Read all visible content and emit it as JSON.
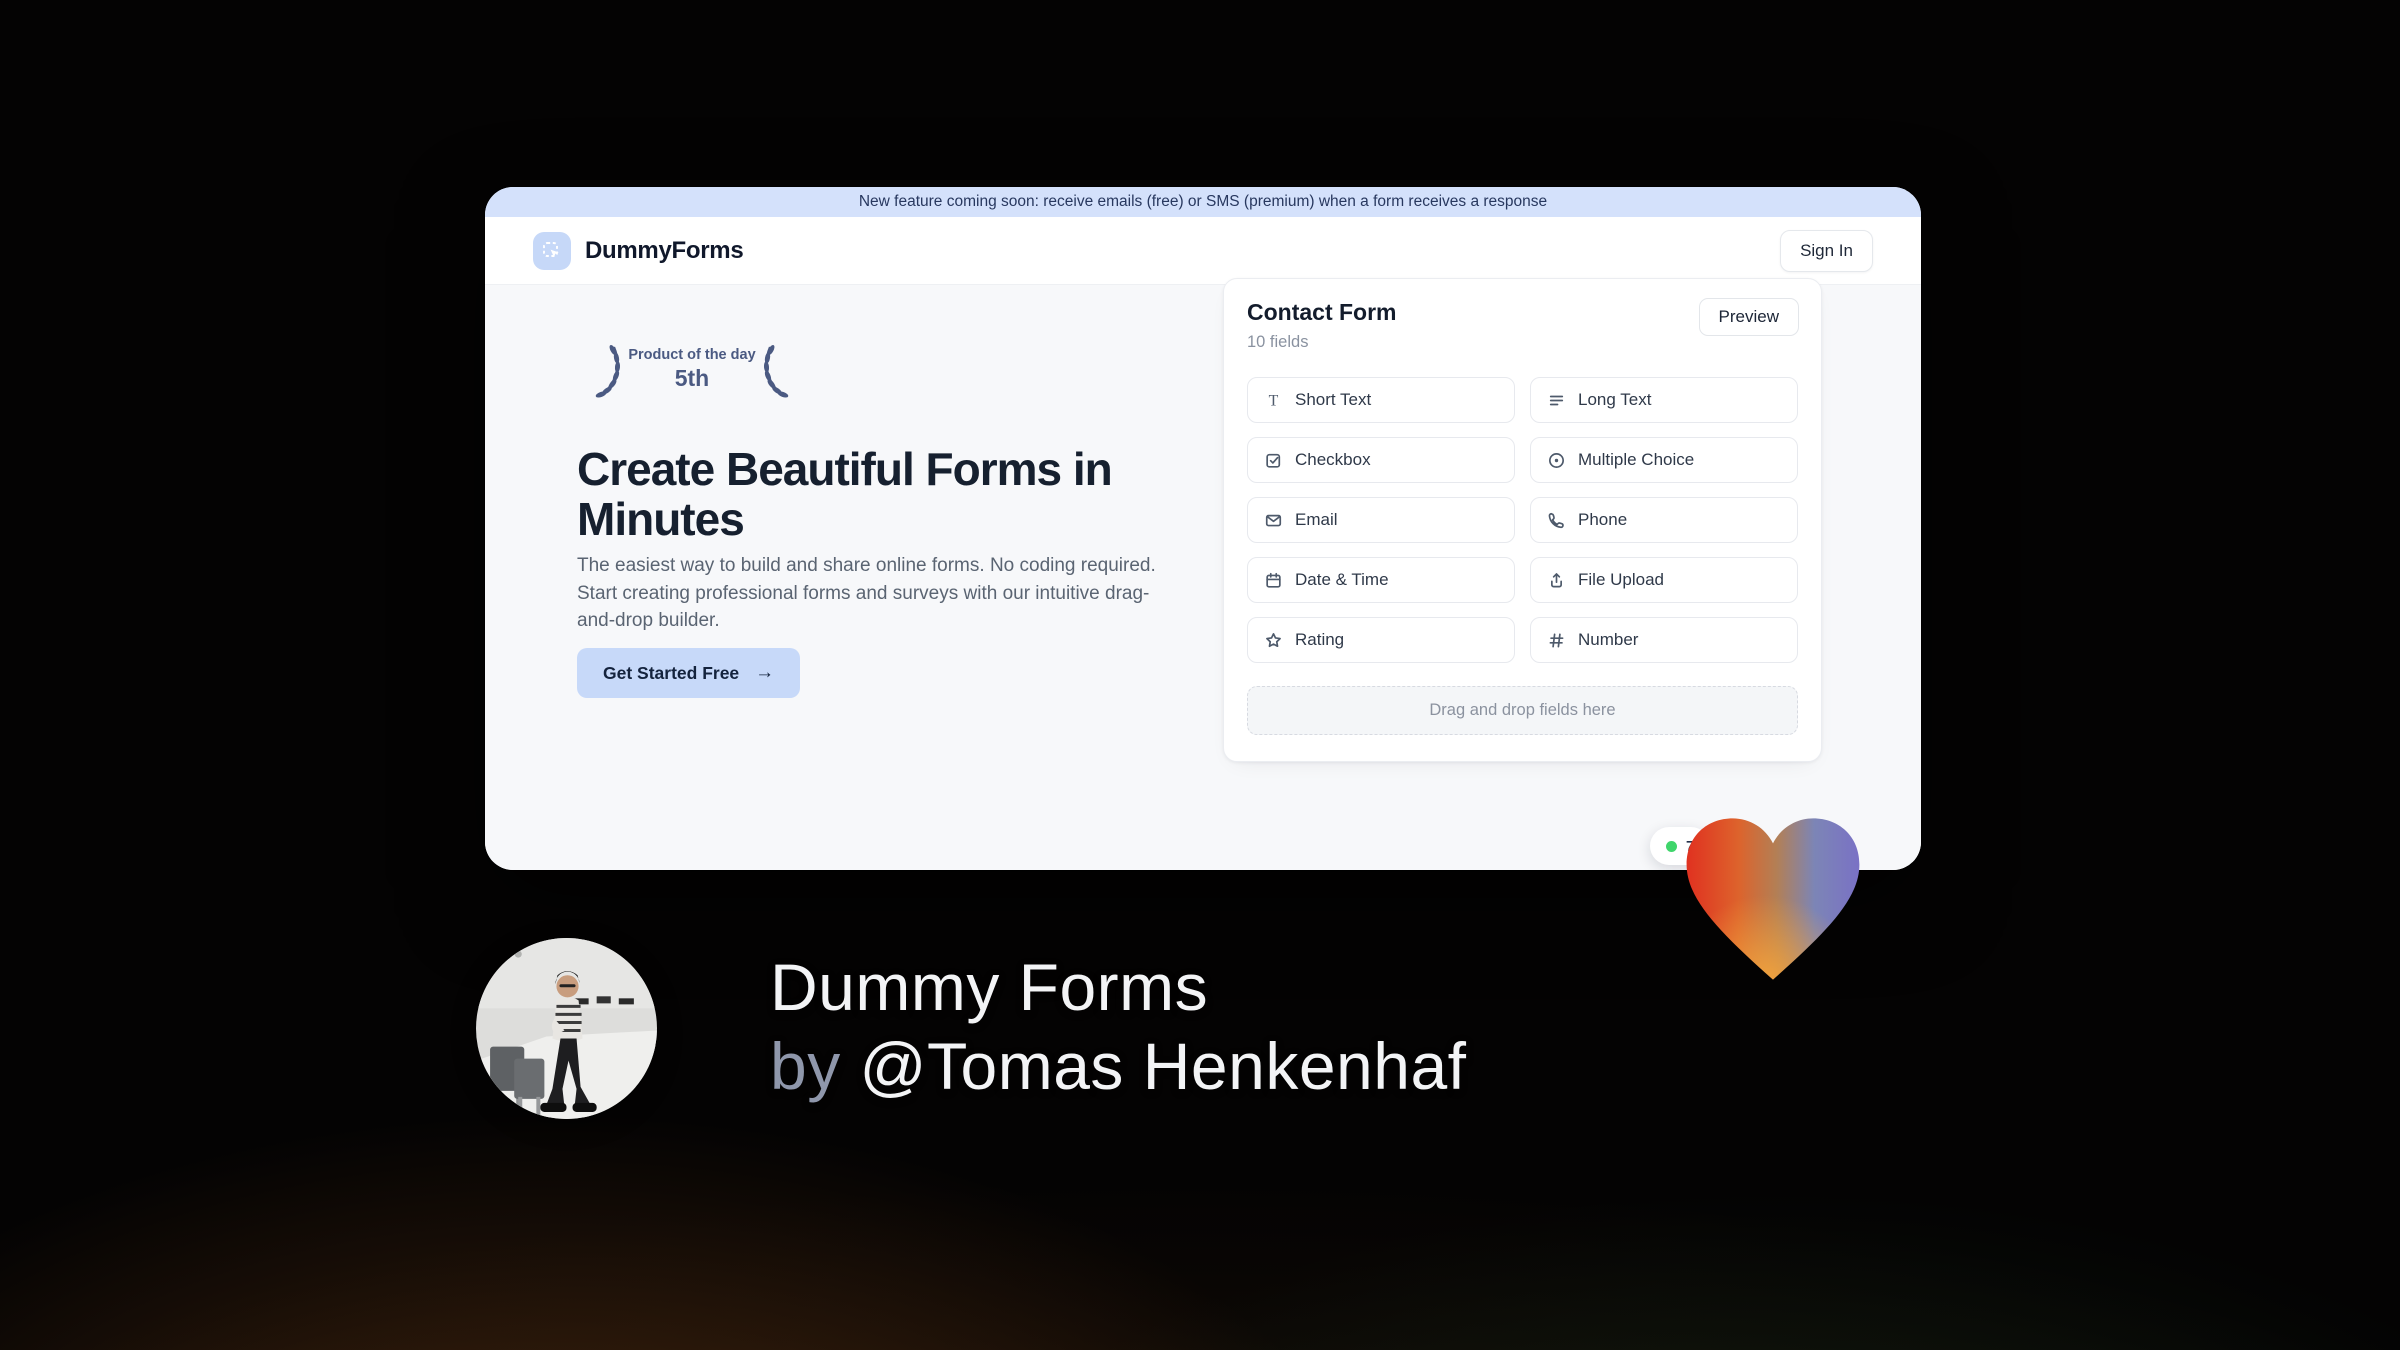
{
  "banner": {
    "text": "New feature coming soon: receive emails (free) or SMS (premium) when a form receives a response"
  },
  "header": {
    "brand": "DummyForms",
    "sign_in_label": "Sign In",
    "logo_icon": "cursor-box-icon"
  },
  "hero": {
    "award": {
      "title": "Product of the day",
      "rank": "5th"
    },
    "heading": "Create Beautiful Forms in Minutes",
    "description": "The easiest way to build and share online forms. No coding required. Start creating professional forms and surveys with our intuitive drag-and-drop builder.",
    "cta_label": "Get Started Free",
    "cta_arrow": "→"
  },
  "builder": {
    "title": "Contact Form",
    "subtitle": "10 fields",
    "preview_label": "Preview",
    "fields": [
      {
        "label": "Short Text",
        "icon": "short-text-icon"
      },
      {
        "label": "Long Text",
        "icon": "long-text-icon"
      },
      {
        "label": "Checkbox",
        "icon": "checkbox-icon"
      },
      {
        "label": "Multiple Choice",
        "icon": "multiple-choice-icon"
      },
      {
        "label": "Email",
        "icon": "email-icon"
      },
      {
        "label": "Phone",
        "icon": "phone-icon"
      },
      {
        "label": "Date & Time",
        "icon": "calendar-icon"
      },
      {
        "label": "File Upload",
        "icon": "upload-icon"
      },
      {
        "label": "Rating",
        "icon": "star-icon"
      },
      {
        "label": "Number",
        "icon": "hash-icon"
      }
    ],
    "dropzone_text": "Drag and drop fields here",
    "status_badge": {
      "text": "7",
      "dot_color": "#3fd56b"
    }
  },
  "footer": {
    "product_name": "Dummy Forms",
    "byline_prefix": "by ",
    "author": "@Tomas Henkenhaf"
  },
  "colors": {
    "banner_bg": "#d4e1fb",
    "accent_blue": "#c7d9f9",
    "status_green": "#3fd56b",
    "heart_red": "#e03120",
    "heart_orange": "#f2a33c",
    "heart_purple": "#7a71c5"
  }
}
